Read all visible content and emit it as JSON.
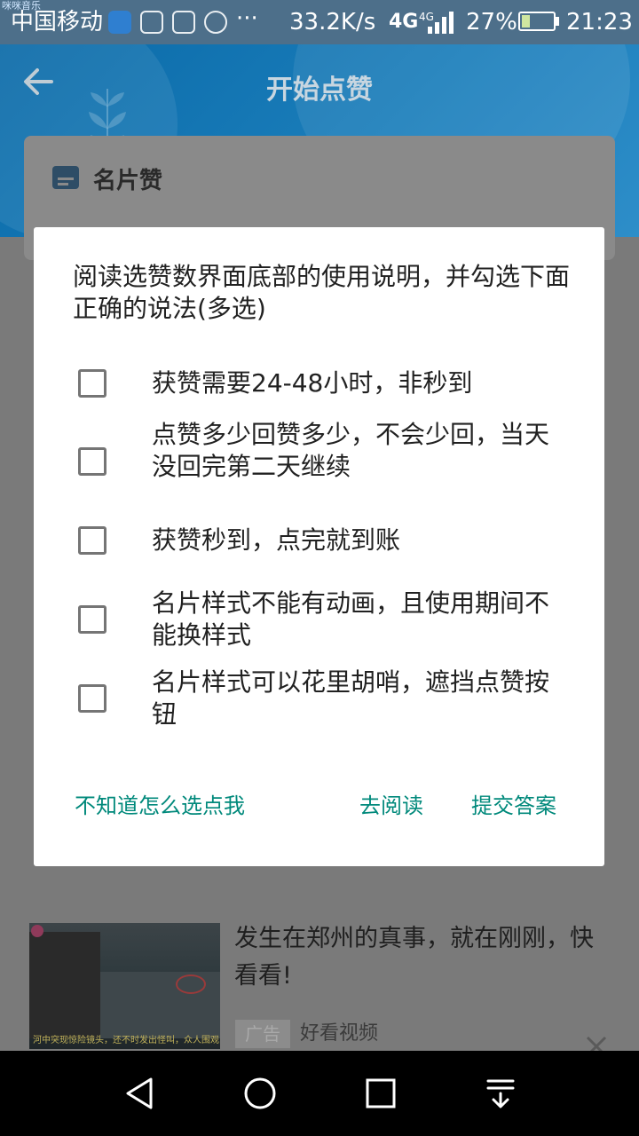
{
  "status_bar": {
    "tiny_label": "咪咪音乐",
    "carrier": "中国移动",
    "more": "···",
    "speed": "33.2K/s",
    "network": "4G",
    "network_small": "4G",
    "battery": "27%",
    "battery_level": 0.27,
    "time": "21:23"
  },
  "header": {
    "title": "开始点赞"
  },
  "card": {
    "title": "名片赞"
  },
  "dialog": {
    "title": "阅读选赞数界面底部的使用说明，并勾选下面正确的说法(多选)",
    "options": [
      {
        "label": "获赞需要24-48小时，非秒到",
        "checked": false
      },
      {
        "label": "点赞多少回赞多少，不会少回，当天没回完第二天继续",
        "checked": false
      },
      {
        "label": "获赞秒到，点完就到账",
        "checked": false
      },
      {
        "label": "名片样式不能有动画，且使用期间不能换样式",
        "checked": false
      },
      {
        "label": "名片样式可以花里胡哨，遮挡点赞按钮",
        "checked": false
      }
    ],
    "buttons": {
      "help": "不知道怎么选点我",
      "read": "去阅读",
      "submit": "提交答案"
    }
  },
  "ad": {
    "headline": "发生在郑州的真事，就在刚刚，快看看!",
    "tag": "广告",
    "source": "好看视频",
    "thumb_caption": "河中突现惊险镜头，还不时发出怪叫，众人围观"
  },
  "colors": {
    "accent": "#00897b",
    "header_blue": "#1a7dba",
    "scrim": "#7a7a7a"
  },
  "icons": {
    "back": "back-arrow-icon",
    "close": "close-icon",
    "nav_back": "triangle-back-icon",
    "nav_home": "circle-home-icon",
    "nav_recent": "square-recent-icon",
    "nav_menu": "pull-down-menu-icon"
  }
}
